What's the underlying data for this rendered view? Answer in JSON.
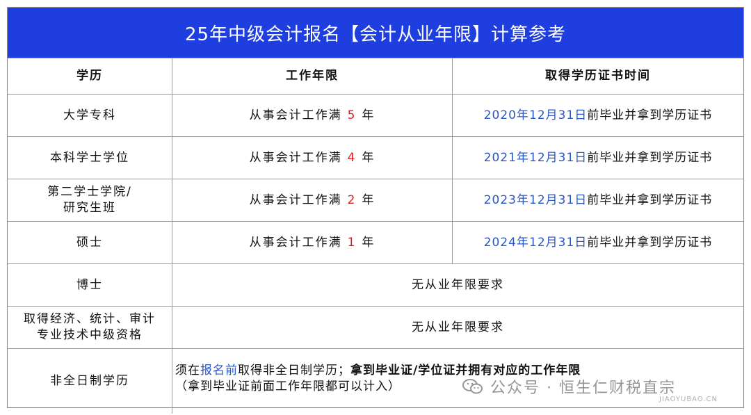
{
  "title": "25年中级会计报名【会计从业年限】计算参考",
  "headers": [
    "学历",
    "工作年限",
    "取得学历证书时间"
  ],
  "rows": [
    {
      "edu": "大学专科",
      "work_pre": "从事会计工作满",
      "years": "5",
      "work_post": "年",
      "date": "2020年12月31日",
      "date_suffix": "前毕业并拿到学历证书"
    },
    {
      "edu": "本科学士学位",
      "work_pre": "从事会计工作满",
      "years": "4",
      "work_post": "年",
      "date": "2021年12月31日",
      "date_suffix": "前毕业并拿到学历证书"
    },
    {
      "edu_line1": "第二学士学院/",
      "edu_line2": "研究生班",
      "work_pre": "从事会计工作满",
      "years": "2",
      "work_post": "年",
      "date": "2023年12月31日",
      "date_suffix": "前毕业并拿到学历证书"
    },
    {
      "edu": "硕士",
      "work_pre": "从事会计工作满",
      "years": "1",
      "work_post": "年",
      "date": "2024年12月31日",
      "date_suffix": "前毕业并拿到学历证书"
    }
  ],
  "merged_rows": [
    {
      "edu": "博士",
      "text": "无从业年限要求"
    },
    {
      "edu_line1": "取得经济、统计、审计",
      "edu_line2": "专业技术中级资格",
      "text": "无从业年限要求"
    }
  ],
  "last_row": {
    "edu": "非全日制学历",
    "line1_pre": "须在",
    "line1_blue": "报名前",
    "line1_mid": "取得非全日制学历；",
    "line1_bold": "拿到毕业证/学位证并拥有对应的工作年限",
    "line2": "（拿到毕业证前面工作年限都可以计入）"
  },
  "watermark": {
    "text": "公众号 · 恒生仁财税直宗",
    "small": "JIAOYUBAO.CN"
  },
  "colors": {
    "header_bg": "#1f3ee0",
    "years": "#e01b1b",
    "date": "#2a57c7"
  }
}
